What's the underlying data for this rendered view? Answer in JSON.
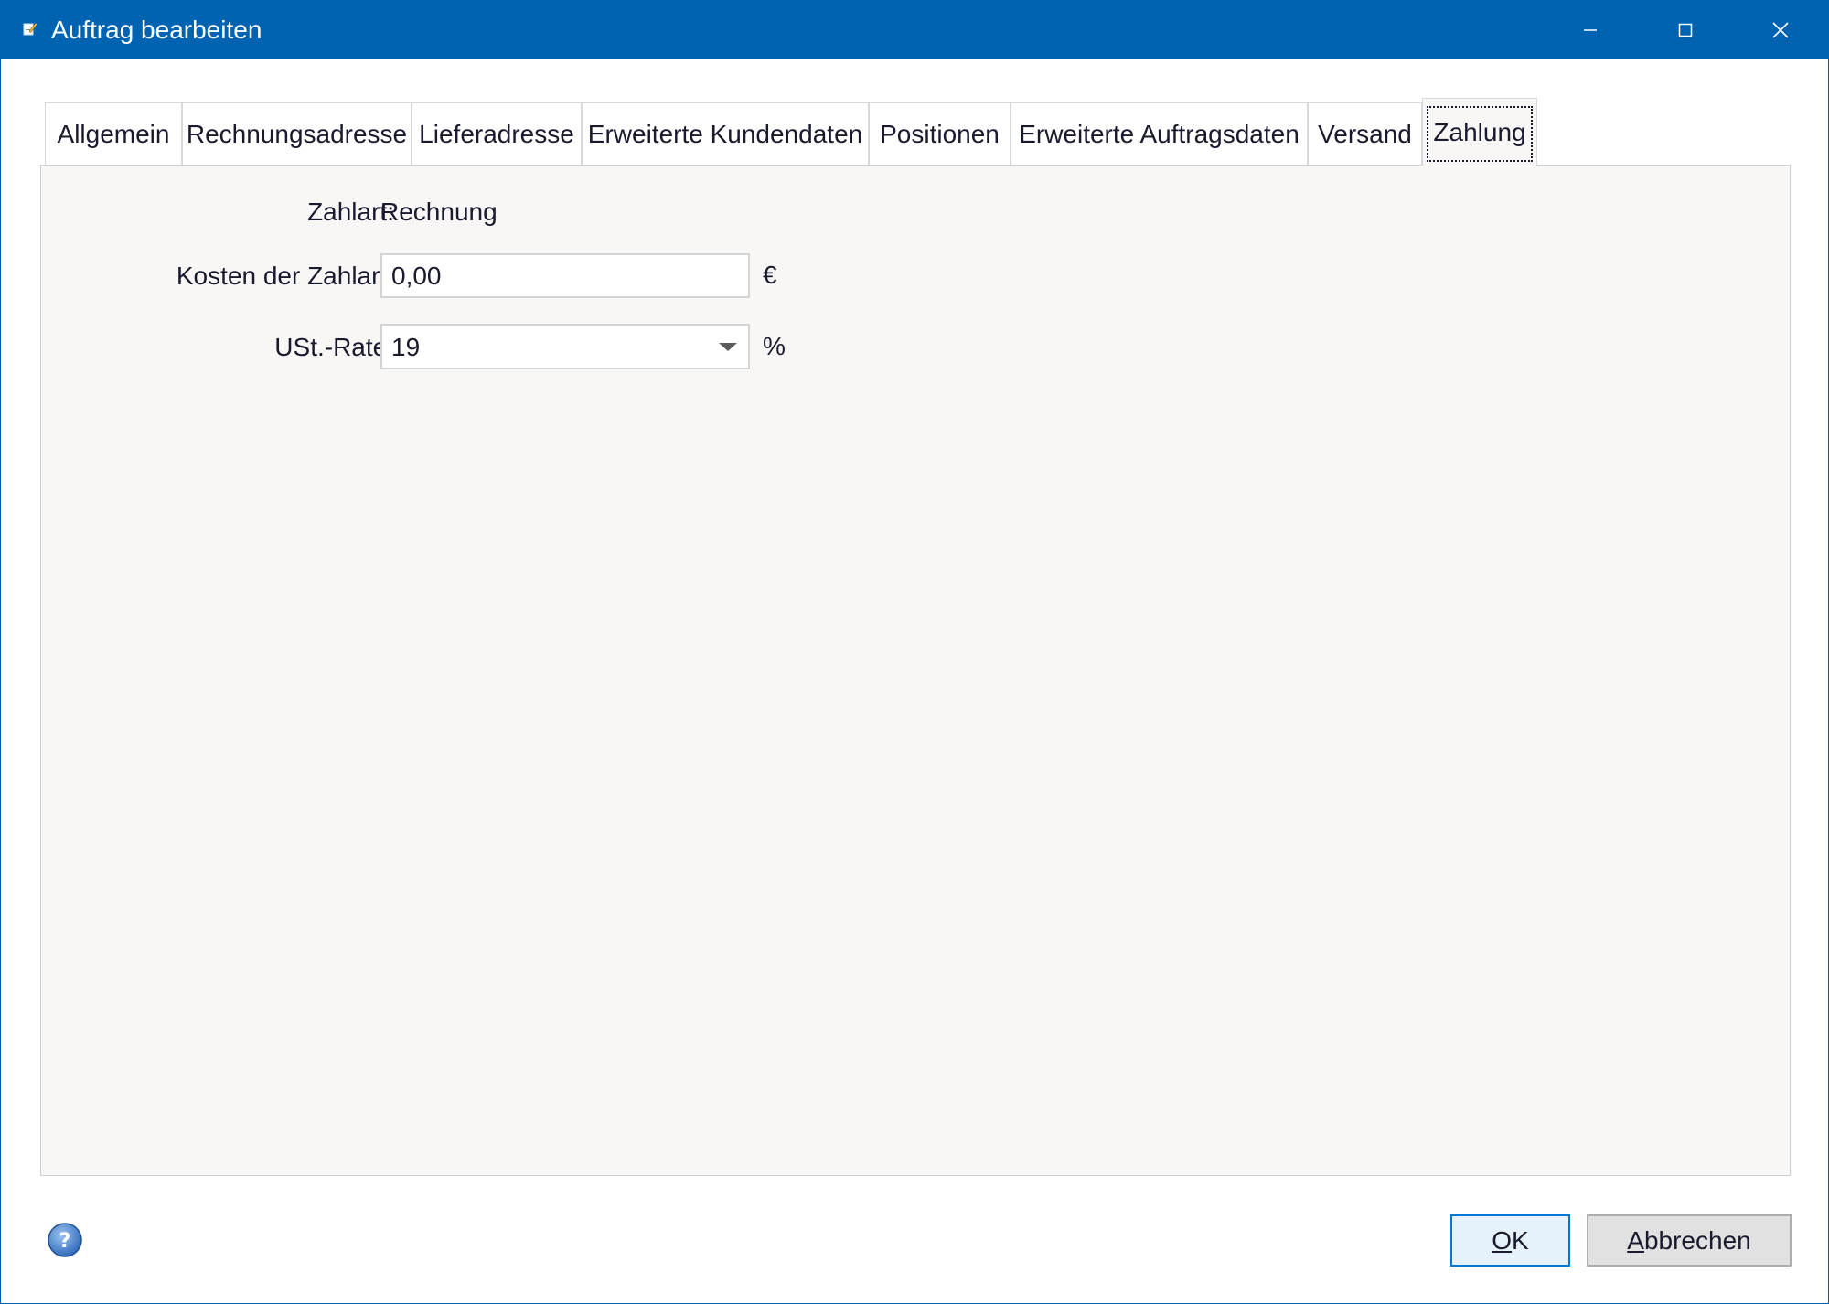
{
  "window": {
    "title": "Auftrag bearbeiten",
    "icon": "edit-document-icon",
    "controls": [
      "minimize-icon",
      "maximize-icon",
      "close-icon"
    ]
  },
  "tabs": [
    {
      "label": "Allgemein",
      "active": false
    },
    {
      "label": "Rechnungsadresse",
      "active": false
    },
    {
      "label": "Lieferadresse",
      "active": false
    },
    {
      "label": "Erweiterte Kundendaten",
      "active": false
    },
    {
      "label": "Positionen",
      "active": false
    },
    {
      "label": "Erweiterte Auftragsdaten",
      "active": false
    },
    {
      "label": "Versand",
      "active": false
    },
    {
      "label": "Zahlung",
      "active": true
    }
  ],
  "payment": {
    "method_label": "Zahlart:",
    "method_value": "Rechnung",
    "cost_label": "Kosten der Zahlart:",
    "cost_value": "0,00",
    "cost_unit": "€",
    "vat_label": "USt.-Rate:",
    "vat_value": "19",
    "vat_unit": "%"
  },
  "footer": {
    "help_icon": "help-icon",
    "ok_mnemonic": "O",
    "ok_rest": "K",
    "cancel_mnemonic": "A",
    "cancel_rest": "bbrechen"
  },
  "colors": {
    "titlebar": "#0063b1",
    "panel_background": "#f8f7f6",
    "ok_border": "#0078d7"
  }
}
